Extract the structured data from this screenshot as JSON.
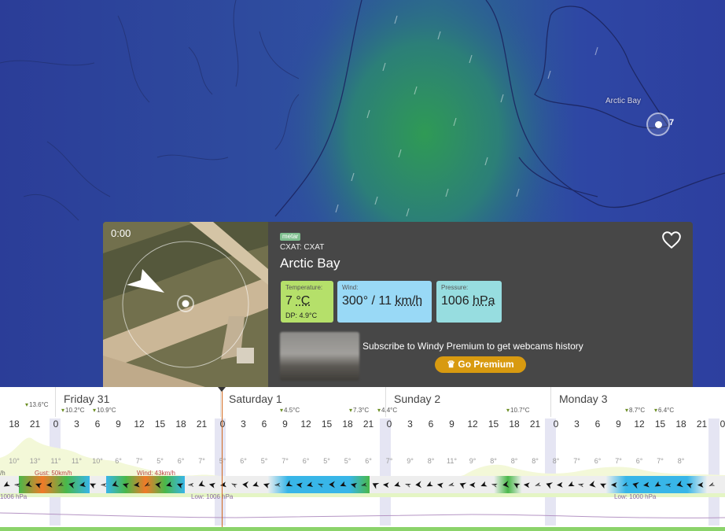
{
  "map": {
    "city_label": "Arctic Bay",
    "station_count": "7"
  },
  "popup": {
    "webcam_time": "0:00",
    "badge": "metar",
    "station_code": "CXAT: CXAT",
    "station_name": "Arctic Bay",
    "favorite_icon": "heart-icon",
    "temperature": {
      "label": "Temperature:",
      "value": "7",
      "unit": "°C",
      "dewpoint": "DP: 4.9°C"
    },
    "wind": {
      "label": "Wind:",
      "value": "300° / 11",
      "unit": "km/h"
    },
    "pressure": {
      "label": "Pressure:",
      "value": "1006",
      "unit": "hPa"
    },
    "subscribe_text": "Subscribe to Windy Premium to get webcams history",
    "premium_button": "Go Premium",
    "premium_icon": "crown-icon"
  },
  "forecast": {
    "days": [
      "Friday 31",
      "Saturday 1",
      "Sunday 2",
      "Monday 3"
    ],
    "hours": [
      "18",
      "21",
      "0",
      "3",
      "6",
      "9",
      "12",
      "15",
      "18",
      "21",
      "0",
      "3",
      "6",
      "9",
      "12",
      "15",
      "18",
      "21",
      "0",
      "3",
      "6",
      "9",
      "12",
      "15",
      "18",
      "21",
      "0",
      "3",
      "6",
      "9",
      "12",
      "15",
      "18",
      "21",
      "0"
    ],
    "temp_marks": [
      "13.6°C",
      "10.2°C",
      "10.9°C",
      "4.5°C",
      "7.3°C",
      "4.4°C",
      "10.7°C",
      "8.7°C",
      "6.4°C"
    ],
    "low_temps": [
      "10°",
      "13°",
      "11°",
      "11°",
      "10°",
      "6°",
      "7°",
      "5°",
      "6°",
      "7°",
      "5°",
      "6°",
      "5°",
      "7°",
      "6°",
      "5°",
      "5°",
      "6°",
      "7°",
      "9°",
      "8°",
      "11°",
      "9°",
      "8°",
      "8°",
      "8°",
      "8°",
      "7°",
      "6°",
      "7°",
      "6°",
      "7°",
      "8°"
    ],
    "gust_label": "Gust: 50km/h",
    "wind_label": "Wind: 43km/h",
    "wind_unit_cut": "/h",
    "pressure_left": "1006 hPa",
    "pressure_low_1": "Low: 1006 hPa",
    "pressure_low_2": "Low: 1000 hPa"
  }
}
